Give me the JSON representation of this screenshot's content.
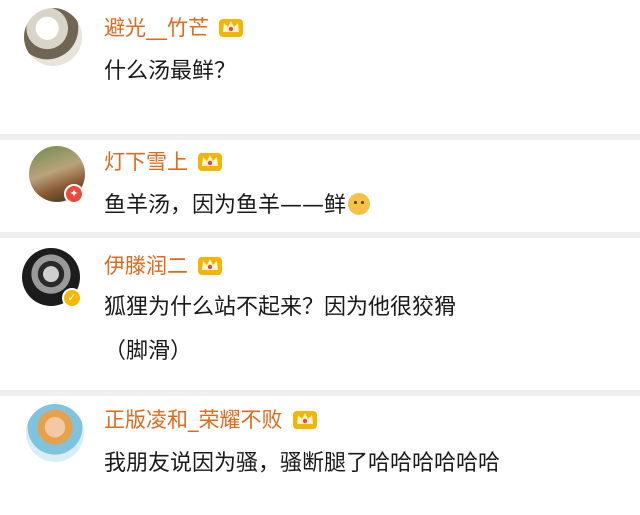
{
  "comments": [
    {
      "username": "避光__竹芒",
      "avatar": "ink-portrait-avatar",
      "badge": null,
      "text_lines": [
        "什么汤最鲜？"
      ]
    },
    {
      "username": "灯下雪上",
      "avatar": "deer-scene-avatar",
      "badge": "red-verified-badge",
      "text_lines": [
        "鱼羊汤，因为鱼羊——鲜"
      ],
      "emoji": "doge-emoji"
    },
    {
      "username": "伊滕润二",
      "avatar": "manga-face-avatar",
      "badge": "gold-verified-badge",
      "text_lines": [
        "狐狸为什么站不起来？因为他很狡猾",
        "（脚滑）"
      ]
    },
    {
      "username": "正版凌和_荣耀不败",
      "avatar": "anime-boy-avatar",
      "badge": null,
      "text_lines": [
        "我朋友说因为骚，骚断腿了哈哈哈哈哈哈"
      ]
    }
  ],
  "icons": {
    "crown": "vip-crown-icon",
    "colors": {
      "username": "#e2691c",
      "crown": "#f2b600",
      "crown_gem": "#e24a3b",
      "background": "#f0f0f0"
    }
  }
}
